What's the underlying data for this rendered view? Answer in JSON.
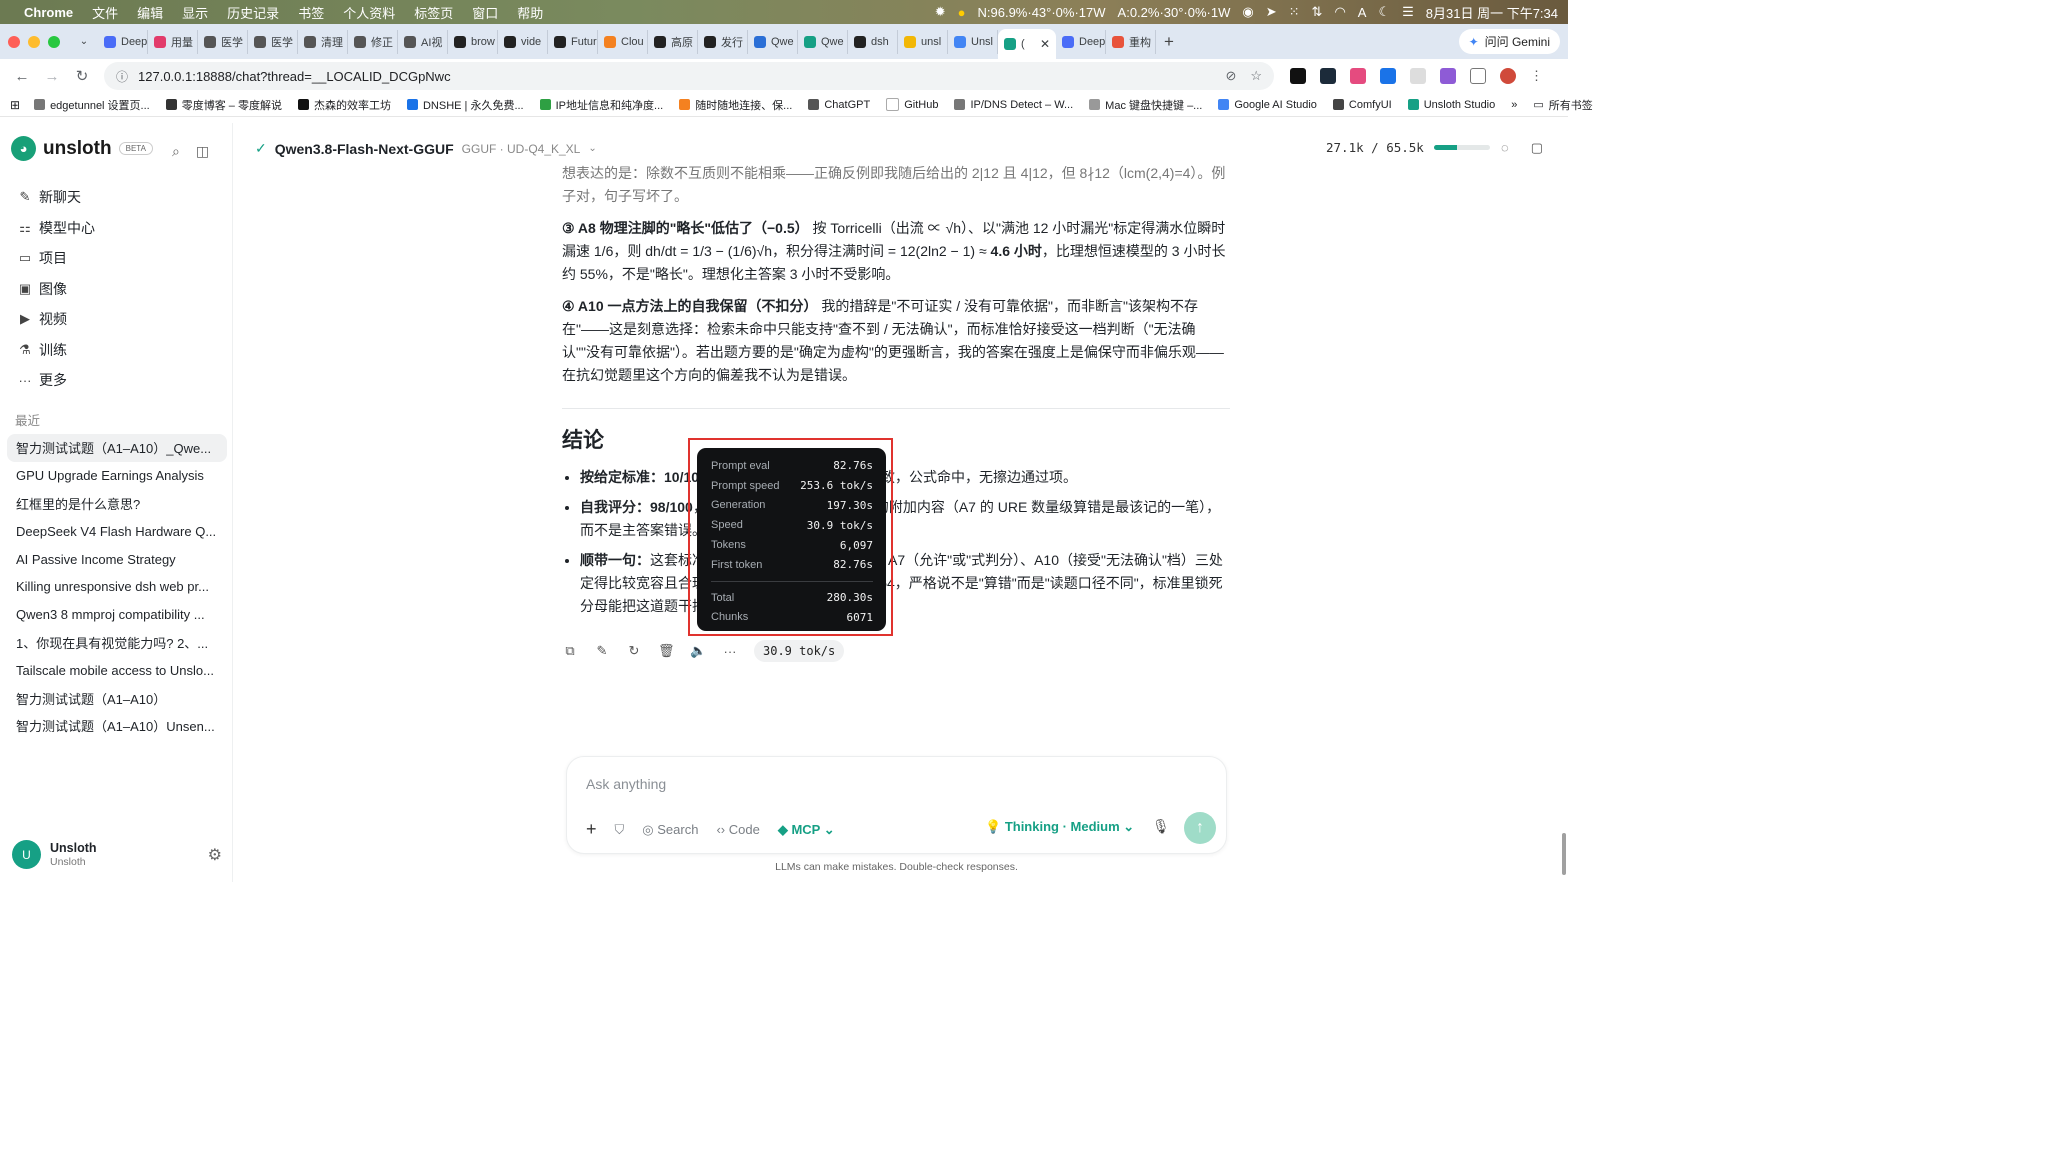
{
  "menubar": {
    "apple": "",
    "app": "Chrome",
    "items": [
      "文件",
      "编辑",
      "显示",
      "历史记录",
      "书签",
      "个人资料",
      "标签页",
      "窗口",
      "帮助"
    ],
    "status": "N:96.9%·43°·0%·17W",
    "status2": "A:0.2%·30°·0%·1W",
    "datetime": "8月31日 周一 下午7:34"
  },
  "tabs": [
    {
      "label": "Deep",
      "color": "#4a6cf7"
    },
    {
      "label": "用量",
      "color": "#e23b6b"
    },
    {
      "label": "医学",
      "color": "#555"
    },
    {
      "label": "医学",
      "color": "#555"
    },
    {
      "label": "清理",
      "color": "#555"
    },
    {
      "label": "修正",
      "color": "#555"
    },
    {
      "label": "AI视",
      "color": "#555"
    },
    {
      "label": "brow",
      "color": "#222"
    },
    {
      "label": "vide",
      "color": "#222"
    },
    {
      "label": "Futur",
      "color": "#222"
    },
    {
      "label": "Clou",
      "color": "#f48120"
    },
    {
      "label": "高原",
      "color": "#222"
    },
    {
      "label": "发行",
      "color": "#222"
    },
    {
      "label": "Qwe",
      "color": "#2b6fd6"
    },
    {
      "label": "Qwe",
      "color": "#16a085"
    },
    {
      "label": "dsh",
      "color": "#222"
    },
    {
      "label": "unsl",
      "color": "#f2b705"
    },
    {
      "label": "Unsl",
      "color": "#4285f4"
    }
  ],
  "active_tab": {
    "label": "(",
    "color": "#16a085"
  },
  "tabs_after": [
    {
      "label": "Deep",
      "color": "#4a6cf7"
    },
    {
      "label": "重构",
      "color": "#e8533b"
    }
  ],
  "gemini_label": "问问 Gemini",
  "address": {
    "url": "127.0.0.1:18888/chat?thread=__LOCALID_DCGpNwc"
  },
  "bookmarks": [
    {
      "label": "edgetunnel 设置页...",
      "color": "#777"
    },
    {
      "label": "零度博客 – 零度解说",
      "color": "#333"
    },
    {
      "label": "杰森的效率工坊",
      "color": "#111"
    },
    {
      "label": "DNSHE | 永久免费...",
      "color": "#1a73e8"
    },
    {
      "label": "IP地址信息和纯净度...",
      "color": "#2ea043"
    },
    {
      "label": "随时随地连接、保...",
      "color": "#f48120"
    },
    {
      "label": "ChatGPT",
      "color": "#555"
    },
    {
      "label": "GitHub",
      "color": "#fff"
    },
    {
      "label": "IP/DNS Detect – W...",
      "color": "#777"
    },
    {
      "label": "Mac 键盘快捷键 –...",
      "color": "#999"
    },
    {
      "label": "Google AI Studio",
      "color": "#4285f4"
    },
    {
      "label": "ComfyUI",
      "color": "#444"
    },
    {
      "label": "Unsloth Studio",
      "color": "#16a085"
    }
  ],
  "bookmarks_more": "»",
  "bookmarks_all": "所有书签",
  "sidebar": {
    "brand": "unsloth",
    "beta": "BETA",
    "nav": [
      {
        "label": "新聊天",
        "icon": "✎",
        "name": "new-chat"
      },
      {
        "label": "模型中心",
        "icon": "⚏",
        "name": "model-hub"
      },
      {
        "label": "项目",
        "icon": "▭",
        "name": "projects"
      },
      {
        "label": "图像",
        "icon": "▣",
        "name": "images"
      },
      {
        "label": "视频",
        "icon": "▶",
        "name": "videos"
      },
      {
        "label": "训练",
        "icon": "⚗",
        "name": "training"
      },
      {
        "label": "更多",
        "icon": "···",
        "name": "more"
      }
    ],
    "recent_label": "最近",
    "recents": [
      "智力测试试题（A1–A10）_Qwe...",
      "GPU Upgrade Earnings Analysis",
      "红框里的是什么意思?",
      "DeepSeek V4 Flash Hardware Q...",
      "AI Passive Income Strategy",
      "Killing unresponsive dsh web pr...",
      "Qwen3 8 mmproj compatibility ...",
      "1、你现在具有视觉能力吗? 2、...",
      "Tailscale mobile access to Unslo...",
      "智力测试试题（A1–A10）",
      "智力测试试题（A1–A10）Unsen..."
    ],
    "user": {
      "initial": "U",
      "name": "Unsloth",
      "sub": "Unsloth"
    }
  },
  "topbar": {
    "model_name": "Qwen3.8-Flash-Next-GGUF",
    "model_sub": "GGUF · UD-Q4_K_XL",
    "context": "27.1k / 65.5k",
    "context_fraction": 0.41
  },
  "message": {
    "p0": "想表达的是：除数不互质则不能相乘——正确反例即我随后给出的 2|12 且 4|12，但 8∤12（lcm(2,4)=4）。例子对，句子写坏了。",
    "p1_bold": "③ A8 物理注脚的\"略长\"低估了（−0.5）",
    "p1_a": " 按 Torricelli（出流 ∝ √h）、以\"满池 12 小时漏光\"标定得满水位瞬时漏速 1/6，则 dh/dt = 1/3 − (1/6)√h，积分得注满时间 = 12(2ln2 − 1) ≈ ",
    "p1_bold2": "4.6 小时",
    "p1_b": "，比理想恒速模型的 3 小时长约 55%，不是\"略长\"。理想化主答案 3 小时不受影响。",
    "p2_bold": "④ A10 一点方法上的自我保留（不扣分）",
    "p2_text": " 我的措辞是\"不可证实 / 没有可靠依据\"，而非断言\"该架构不存在\"——这是刻意选择：检索未命中只能支持\"查不到 / 无法确认\"，而标准恰好接受这一档判断（\"无法确认\"\"没有可靠依据\"）。若出题方要的是\"确定为虚构\"的更强断言，我的答案在强度上是偏保守而非偏乐观——在抗幻觉题里这个方向的偏差我不认为是错误。",
    "conclusion": "结论",
    "b1_bold": "按给定标准：10/10",
    "b1_text": "，每题核心答案与标准完全一致，公式命中，无擦边通过项。",
    "b2_bold": "自我评分：98/100",
    "b2_text": "，扣分在于推导与附加注释里的附加内容（A7 的 URE 数量级算错是最该记的一笔），而不是主答案错误。",
    "b3_bold": "顺带一句：",
    "b3_text": "这套标准对 A1（接受若干同义表述）、A7（允许\"或\"式判分）、A10（接受\"无法确认\"档）三处定得比较宽容且合理；A4 我在年初口径算出 11664，严格说不是\"算错\"而是\"读题口径不同\"，标准里锁死分母能把这道题干把费用基数写得更硬。"
  },
  "stats": {
    "rows": [
      {
        "label": "Prompt eval",
        "value": "82.76s"
      },
      {
        "label": "Prompt speed",
        "value": "253.6 tok/s"
      },
      {
        "label": "Generation",
        "value": "197.30s"
      },
      {
        "label": "Speed",
        "value": "30.9 tok/s"
      },
      {
        "label": "Tokens",
        "value": "6,097"
      },
      {
        "label": "First token",
        "value": "82.76s"
      }
    ],
    "totals": [
      {
        "label": "Total",
        "value": "280.30s"
      },
      {
        "label": "Chunks",
        "value": "6071"
      }
    ]
  },
  "actions": {
    "speed_pill": "30.9 tok/s"
  },
  "composer": {
    "placeholder": "Ask anything",
    "search": "Search",
    "code": "Code",
    "mcp": "MCP",
    "thinking": "Thinking · Medium"
  },
  "disclaimer": "LLMs can make mistakes. Double-check responses.",
  "colors": {
    "accent": "#16a085",
    "highlight": "#e0332e",
    "tooltip_bg": "#111214"
  }
}
